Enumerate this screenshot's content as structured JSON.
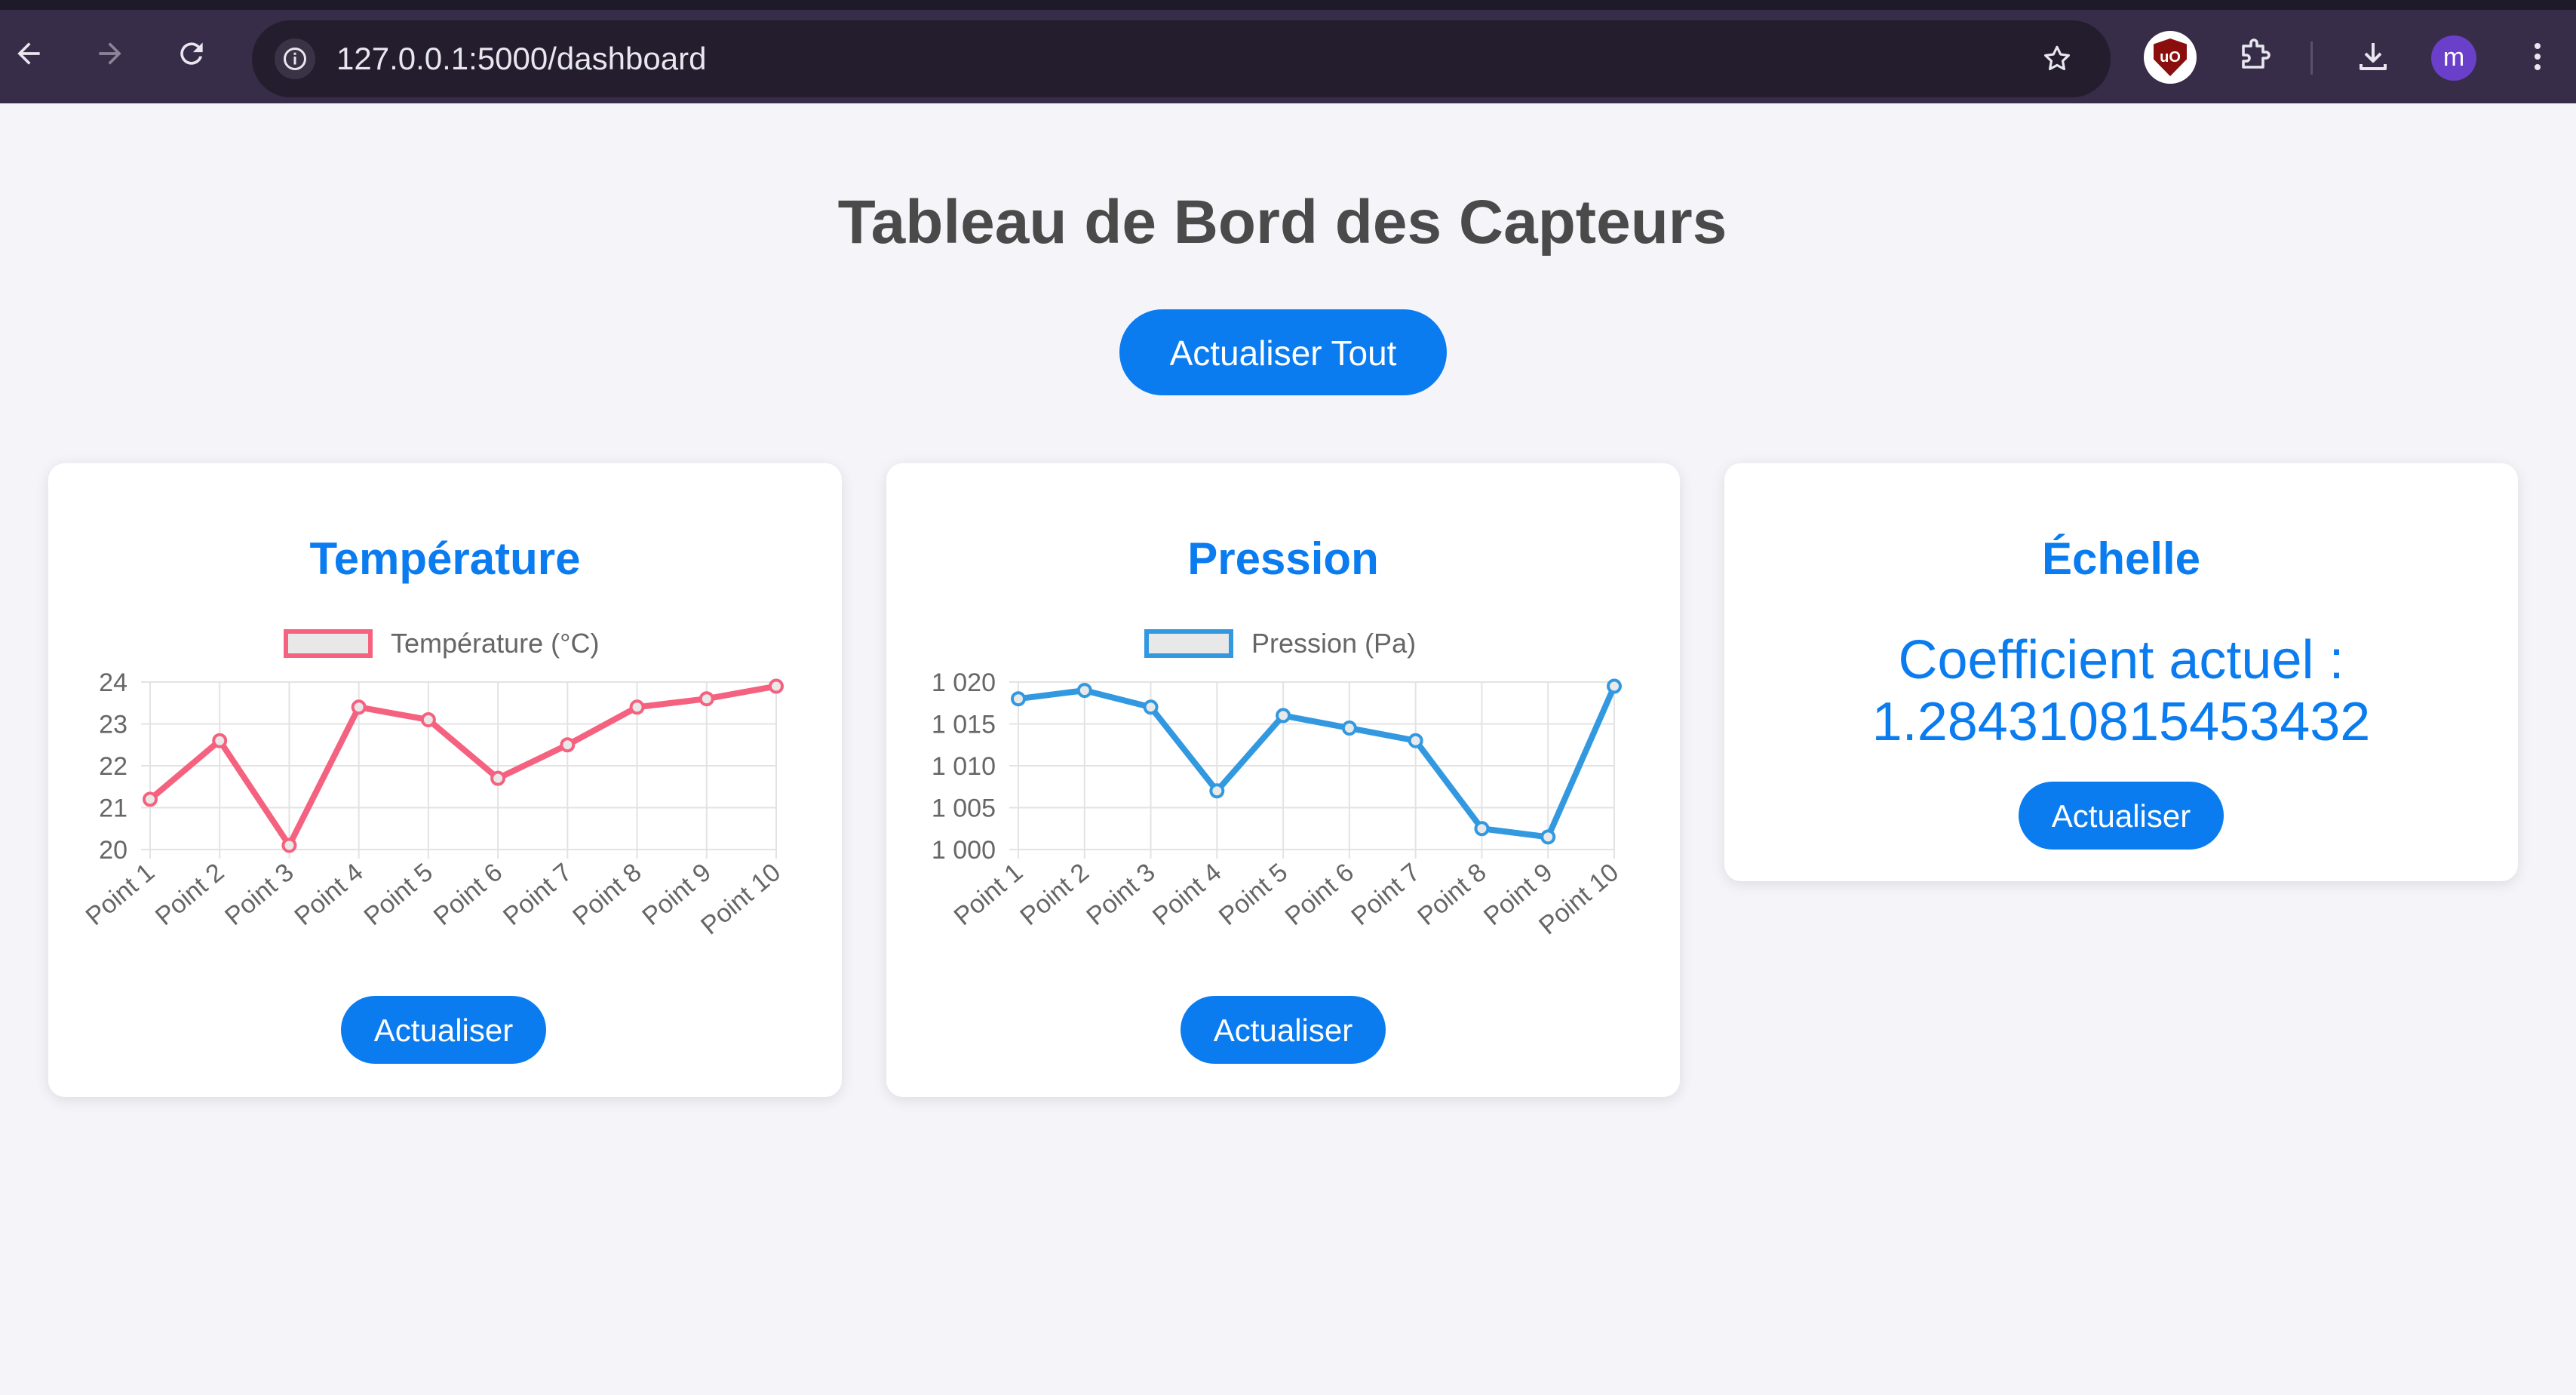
{
  "browser": {
    "url": "127.0.0.1:5000/dashboard",
    "avatar_letter": "m",
    "ext_label": "uO"
  },
  "page": {
    "title": "Tableau de Bord des Capteurs",
    "refresh_all_label": "Actualiser Tout"
  },
  "cards": {
    "temperature": {
      "title": "Température",
      "refresh_label": "Actualiser"
    },
    "pressure": {
      "title": "Pression",
      "refresh_label": "Actualiser"
    },
    "scale": {
      "title": "Échelle",
      "coef_label": "Coefficient actuel :",
      "coef_value": "1.284310815453432",
      "refresh_label": "Actualiser"
    }
  },
  "colors": {
    "accent": "#0a7cf0",
    "temperature_line": "#f5627f",
    "pressure_line": "#3299e0"
  },
  "chart_data": [
    {
      "type": "line",
      "categories": [
        "Point 1",
        "Point 2",
        "Point 3",
        "Point 4",
        "Point 5",
        "Point 6",
        "Point 7",
        "Point 8",
        "Point 9",
        "Point 10"
      ],
      "series": [
        {
          "name": "Température (°C)",
          "values": [
            21.2,
            22.6,
            20.1,
            23.4,
            23.1,
            21.7,
            22.5,
            23.4,
            23.6,
            23.9
          ]
        }
      ],
      "ylim": [
        20,
        24
      ],
      "yticks": [
        20,
        21,
        22,
        23,
        24
      ],
      "ytick_labels": [
        "20",
        "21",
        "22",
        "23",
        "24"
      ],
      "grid": true,
      "legend": "top-center"
    },
    {
      "type": "line",
      "categories": [
        "Point 1",
        "Point 2",
        "Point 3",
        "Point 4",
        "Point 5",
        "Point 6",
        "Point 7",
        "Point 8",
        "Point 9",
        "Point 10"
      ],
      "series": [
        {
          "name": "Pression (Pa)",
          "values": [
            1018,
            1019,
            1017,
            1007,
            1016,
            1014.5,
            1013,
            1002.5,
            1001.5,
            1019.5
          ]
        }
      ],
      "ylim": [
        1000,
        1020
      ],
      "yticks": [
        1000,
        1005,
        1010,
        1015,
        1020
      ],
      "ytick_labels": [
        "1 000",
        "1 005",
        "1 010",
        "1 015",
        "1 020"
      ],
      "grid": true,
      "legend": "top-center"
    }
  ]
}
